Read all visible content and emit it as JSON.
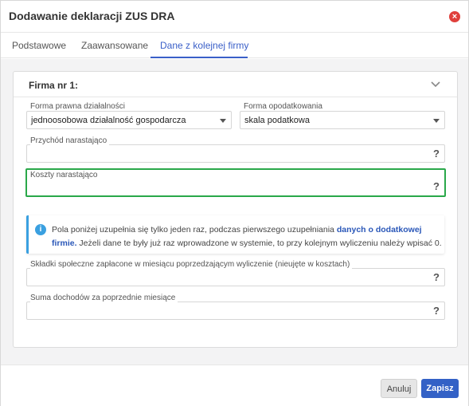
{
  "dialog": {
    "title": "Dodawanie deklaracji ZUS DRA",
    "close_icon": "close-icon",
    "close_glyph": "×"
  },
  "tabs": [
    {
      "label": "Podstawowe",
      "active": false
    },
    {
      "label": "Zaawansowane",
      "active": false
    },
    {
      "label": "Dane z kolejnej firmy",
      "active": true
    }
  ],
  "card": {
    "title": "Firma nr 1:",
    "chevron_icon": "chevron-down-icon"
  },
  "fields": {
    "forma_prawna": {
      "label": "Forma prawna działalności",
      "value": "jednoosobowa działalność gospodarcza"
    },
    "forma_opodatkowania": {
      "label": "Forma opodatkowania",
      "value": "skala podatkowa"
    },
    "przychod": {
      "label": "Przychód narastająco",
      "value": ""
    },
    "koszty": {
      "label": "Koszty narastająco",
      "value": ""
    },
    "skladki": {
      "label": "Składki społeczne zapłacone w miesiącu poprzedzającym wyliczenie (nieujęte w kosztach)",
      "value": ""
    },
    "suma_dochodow": {
      "label": "Suma dochodów za poprzednie miesiące",
      "value": ""
    }
  },
  "help_glyph": "?",
  "info": {
    "icon_glyph": "i",
    "text_before": "Pola poniżej uzupełnia się tylko jeden raz, podczas pierwszego uzupełniania ",
    "link": "danych o dodatkowej firmie.",
    "text_after": " Jeżeli dane te były już raz wprowadzone w systemie, to przy kolejnym wyliczeniu należy wpisać 0."
  },
  "footer": {
    "cancel_label": "Anuluj",
    "save_label": "Zapisz"
  },
  "colors": {
    "accent": "#3a5fc8",
    "highlight_border": "#2aa84a",
    "close": "#e0403c",
    "info": "#3aa0e0"
  }
}
